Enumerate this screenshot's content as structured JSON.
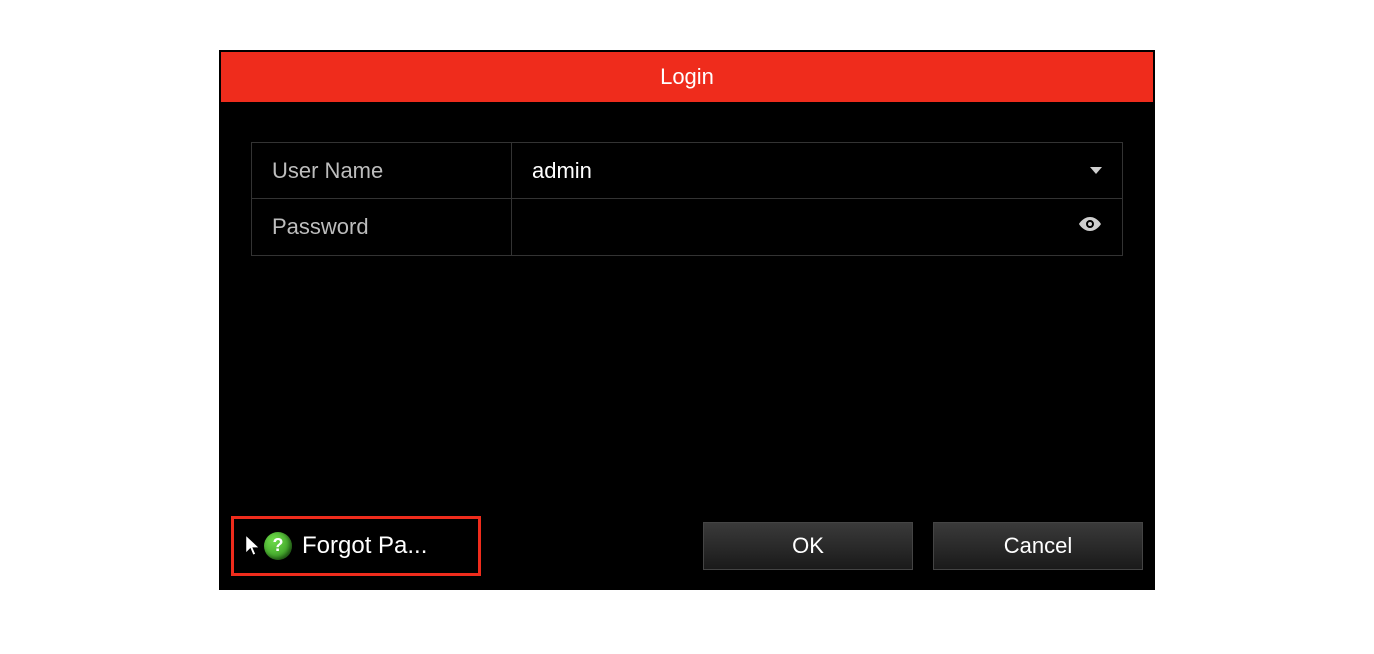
{
  "dialog": {
    "title": "Login",
    "fields": {
      "username_label": "User Name",
      "username_value": "admin",
      "password_label": "Password",
      "password_value": ""
    },
    "forgot_label": "Forgot Pa...",
    "help_glyph": "?",
    "buttons": {
      "ok": "OK",
      "cancel": "Cancel"
    }
  }
}
